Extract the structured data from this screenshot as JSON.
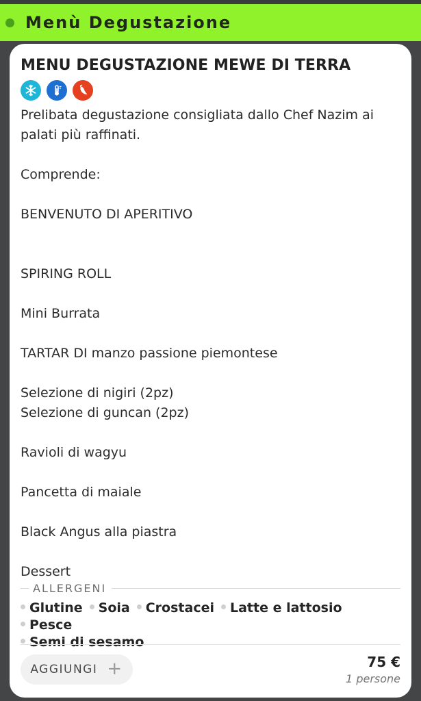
{
  "header": {
    "title": "Menù Degustazione"
  },
  "item": {
    "title": "MENU DEGUSTAZIONE MEWE DI TERRA",
    "icons": [
      "snowflake-icon",
      "thermometer-icon",
      "chili-pepper-icon"
    ],
    "description": {
      "intro": "Prelibata degustazione consigliata dallo Chef Nazim ai palati più raffinati.",
      "comprende": "Comprende:",
      "benvenuto": "BENVENUTO DI APERITIVO",
      "spiring": "SPIRING ROLL",
      "burrata": "Mini Burrata",
      "tartar": "TARTAR DI manzo passione piemontese",
      "nigiri": "Selezione di nigiri (2pz)",
      "guncan": "Selezione di guncan (2pz)",
      "ravioli": "Ravioli di wagyu",
      "pancetta": "Pancetta di maiale",
      "angus": "Black Angus alla piastra",
      "dessert": "Dessert"
    },
    "allergens_label": "ALLERGENI",
    "allergens": [
      "Glutine",
      "Soia",
      "Crostacei",
      "Latte e lattosio",
      "Pesce",
      "Semi di sesamo"
    ],
    "add_label": "AGGIUNGI",
    "add_icon": "plus-icon",
    "price": "75 €",
    "persons": "1 persone"
  },
  "colors": {
    "header_bg": "#8ff22a",
    "snow_badge": "#1fb5d6",
    "temp_badge": "#1d6fd2",
    "chili_badge": "#e5401f"
  }
}
